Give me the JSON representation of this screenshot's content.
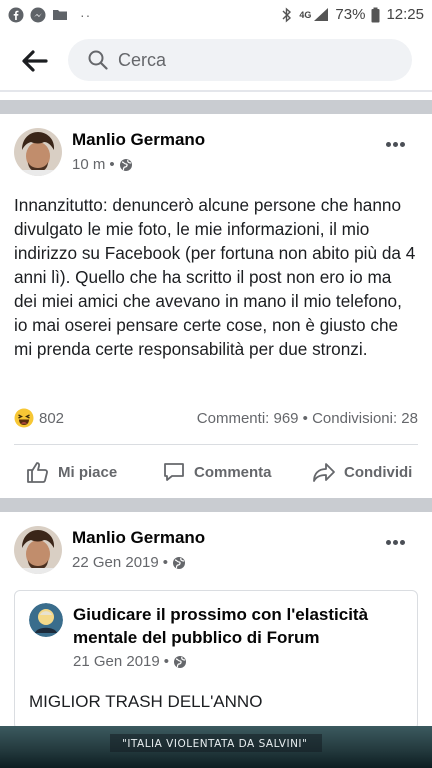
{
  "status_bar": {
    "network": "4G",
    "battery": "73%",
    "time": "12:25",
    "dots": "··"
  },
  "search": {
    "placeholder": "Cerca"
  },
  "posts": [
    {
      "author": "Manlio Germano",
      "time": "10 m",
      "privacy_icon": "globe-icon",
      "text": "Innanzitutto: denuncerò alcune persone che hanno divulgato le mie foto, le mie informazioni, il mio indirizzo su Facebook (per fortuna non abito più da 4 anni lì). Quello che ha scritto il post non ero io ma dei miei amici che avevano in mano il mio telefono, io mai oserei pensare certe cose, non è giusto che mi prenda certe responsabilità per due stronzi.",
      "reaction_icon": "haha-emoji",
      "reaction_count": "802",
      "counts": "Commenti: 969 • Condivisioni: 28",
      "actions": {
        "like": "Mi piace",
        "comment": "Commenta",
        "share": "Condividi"
      }
    },
    {
      "author": "Manlio Germano",
      "time": "22 Gen 2019",
      "privacy_icon": "globe-icon",
      "shared": {
        "title": "Giudicare il prossimo con l'elasticità mentale del pubblico di Forum",
        "time": "21 Gen 2019",
        "text": "MIGLIOR TRASH DELL'ANNO",
        "video_caption": "\"ITALIA VIOLENTATA DA SALVINI\""
      }
    }
  ],
  "colors": {
    "divider": "#c9ccd1",
    "muted": "#65676b",
    "search_bg": "#f0f2f5"
  }
}
